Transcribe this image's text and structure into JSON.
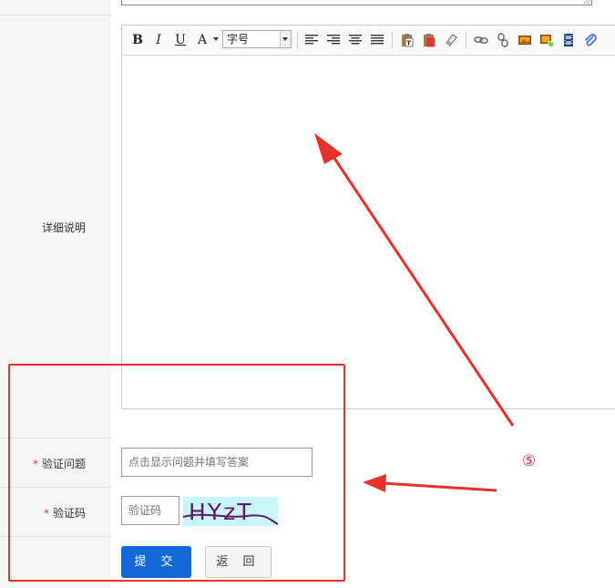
{
  "form": {
    "detail_label": "详细说明",
    "question_label": "验证问题",
    "captcha_label": "验证码",
    "required_mark": "*",
    "question_placeholder": "点击显示问题并填写答案",
    "captcha_placeholder": "验证码",
    "captcha_text": "HYzT",
    "submit_label": "提 交",
    "back_label": "返 回"
  },
  "toolbar": {
    "bold": "B",
    "italic": "I",
    "underline": "U",
    "font_color": "A",
    "font_size_select": "字号"
  },
  "annotation": {
    "number": "⑤",
    "color": "#e8302c"
  },
  "colors": {
    "primary_button": "#1267d6",
    "required": "#e4393c",
    "captcha_bg": "#c9f6f9"
  }
}
